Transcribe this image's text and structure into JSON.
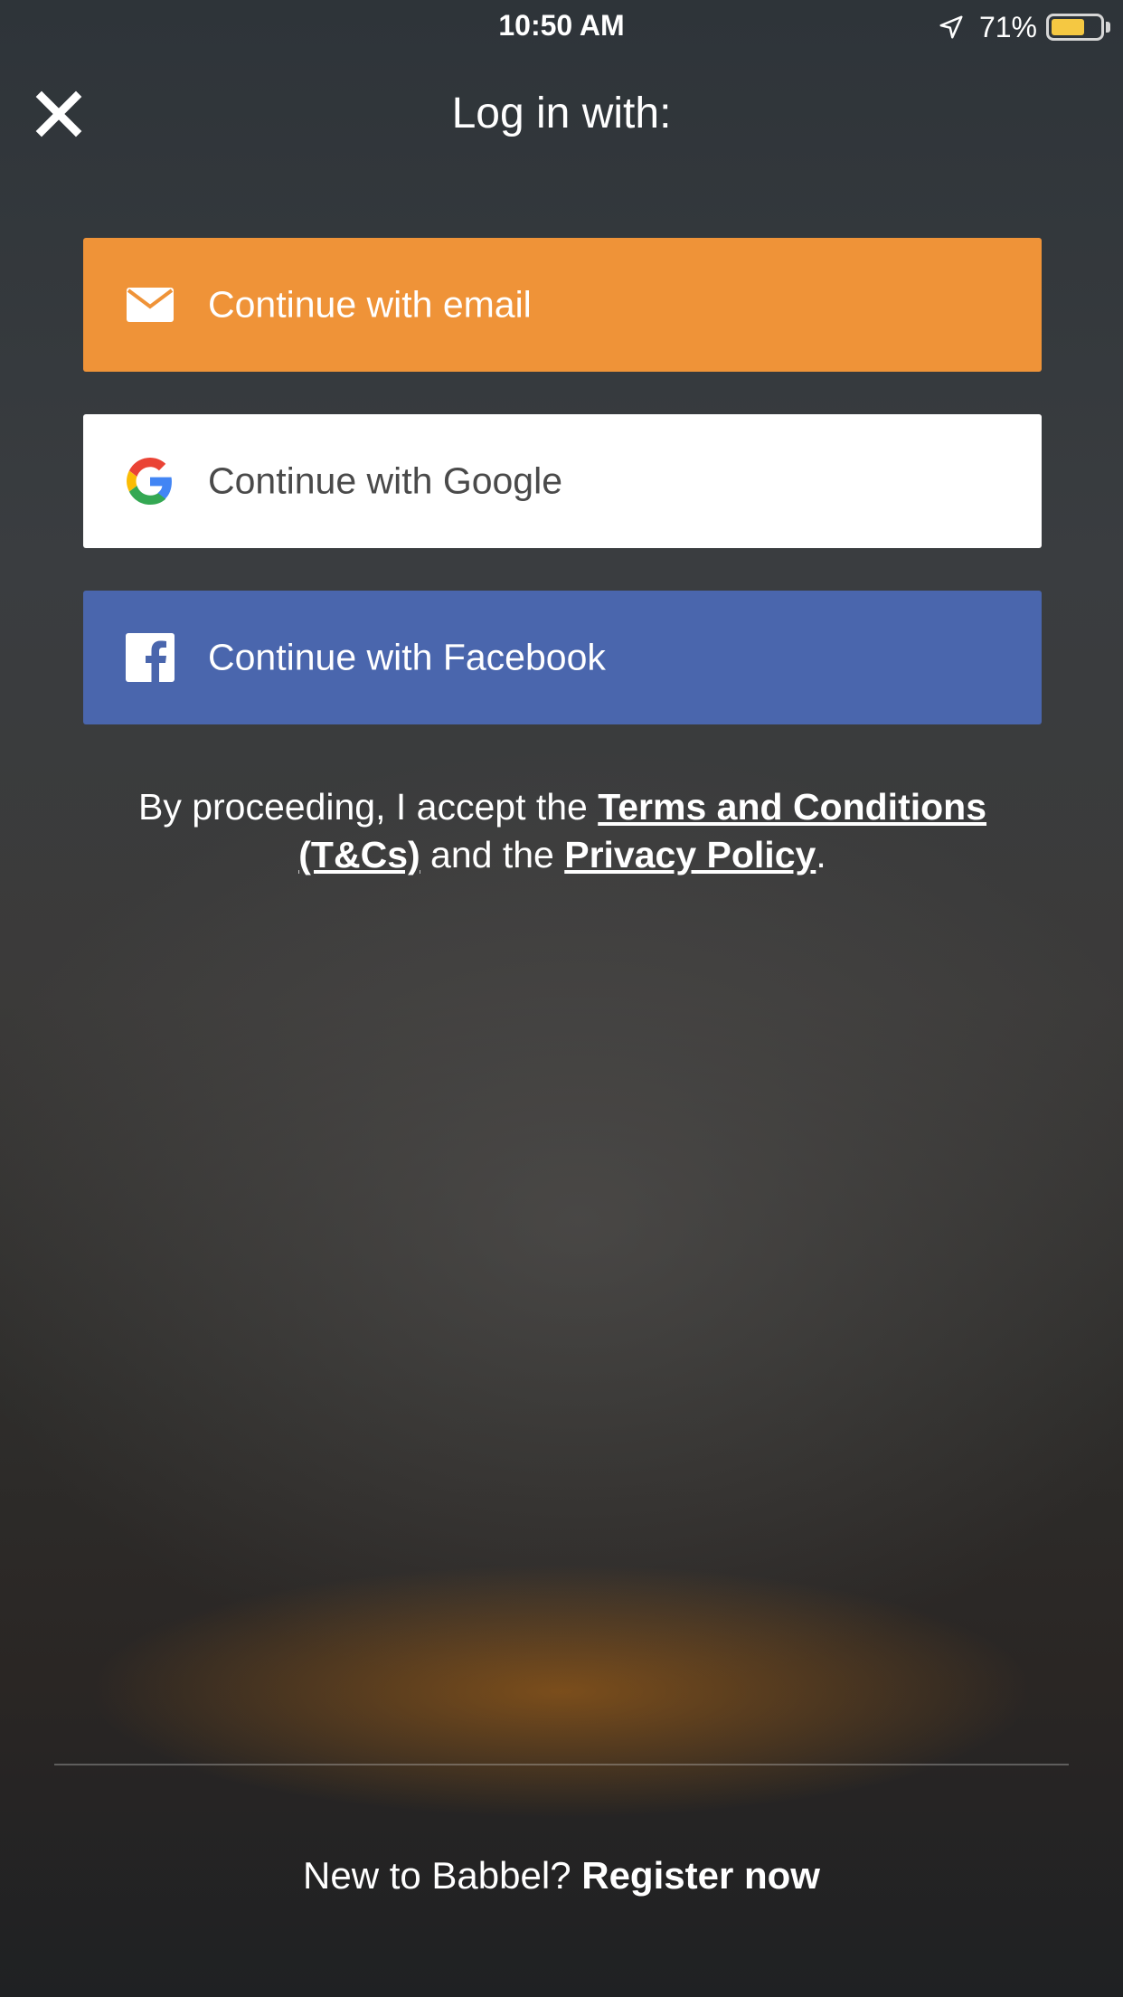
{
  "status_bar": {
    "time": "10:50 AM",
    "battery_percent": "71%",
    "battery_level": 0.71,
    "icons": [
      "location-arrow-icon",
      "battery-icon"
    ],
    "battery_color": "#f5c842"
  },
  "header": {
    "close_icon": "close-icon",
    "title": "Log in with:"
  },
  "login_buttons": {
    "email": {
      "label": "Continue with email",
      "icon": "email-icon",
      "color": "#ef9338"
    },
    "google": {
      "label": "Continue with Google",
      "icon": "google-logo",
      "color": "#ffffff"
    },
    "facebook": {
      "label": "Continue with Facebook",
      "icon": "facebook-icon",
      "color": "#4a66ad"
    }
  },
  "legal": {
    "prefix": "By proceeding, I accept the ",
    "terms_link": "Terms and Conditions (T&Cs)",
    "middle": " and the ",
    "privacy_link": "Privacy Policy",
    "suffix": "."
  },
  "footer": {
    "prompt": "New to Babbel? ",
    "register_link": "Register now"
  }
}
